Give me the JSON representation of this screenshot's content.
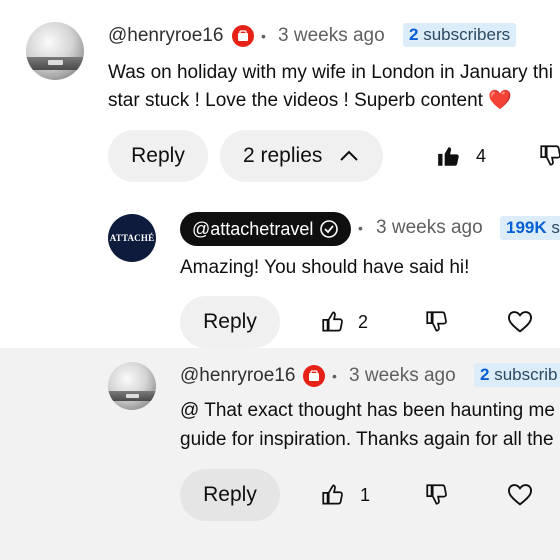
{
  "comments": [
    {
      "handle": "@henryroe16",
      "time": "3 weeks ago",
      "subscribers_count": "2",
      "subscribers_label": "subscribers",
      "text_line1": "Was on holiday with my wife in London in January thi",
      "text_line2": "star stuck ! Love the videos ! Superb content ❤️",
      "reply_label": "Reply",
      "replies_label": "2 replies",
      "like_count": "4"
    },
    {
      "handle": "@attachetravel",
      "avatar_text": "ATTACHÉ",
      "time": "3 weeks ago",
      "subscribers_count": "199K",
      "subscribers_label": "s",
      "text_line1": "Amazing! You should have said hi!",
      "reply_label": "Reply",
      "like_count": "2"
    },
    {
      "handle": "@henryroe16",
      "time": "3 weeks ago",
      "subscribers_count": "2",
      "subscribers_label": "subscrib",
      "text_line1": "@ That exact thought has been haunting me",
      "text_line2": "guide for inspiration. Thanks again for all the",
      "reply_label": "Reply",
      "like_count": "1"
    }
  ],
  "colors": {
    "accent": "#065fd4",
    "badge_bg": "#dcecf9",
    "highlight": "#f2f2f2",
    "heart": "#e02020"
  }
}
